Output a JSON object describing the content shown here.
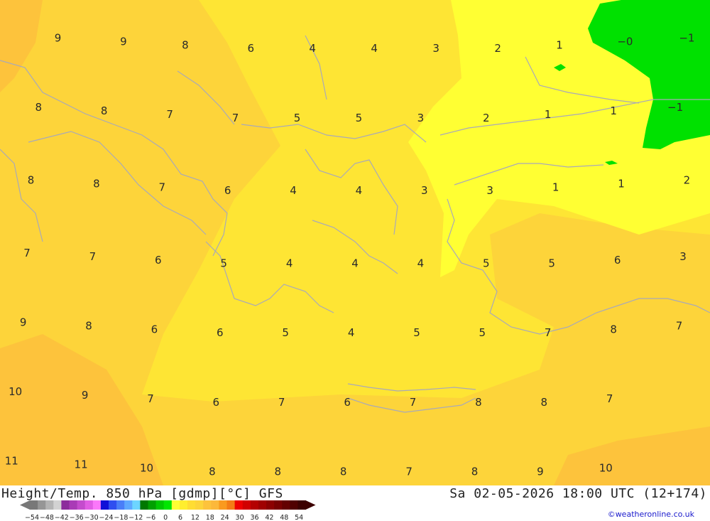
{
  "title": "Height/Temp. 850 hPa [gdmp][°C] GFS",
  "timestamp": "Sa 02-05-2026 18:00 UTC (12+174)",
  "credit": "©weatheronline.co.uk",
  "colors": {
    "zone_6_8": "#fdd43a",
    "zone_4_6": "#fee534",
    "zone_2_4": "#ffff33",
    "zone_neg2_0": "#00e100",
    "zone_8_10": "#fdc33c",
    "coastline": "#a9a9b8"
  },
  "field_values": [
    {
      "label": "9",
      "lon": 13.7,
      "lat": 44.4
    },
    {
      "label": "9",
      "lon": 15.4,
      "lat": 44.3
    },
    {
      "label": "8",
      "lon": 17.0,
      "lat": 44.2
    },
    {
      "label": "6",
      "lon": 18.7,
      "lat": 44.1
    },
    {
      "label": "4",
      "lon": 20.3,
      "lat": 44.1
    },
    {
      "label": "4",
      "lon": 21.9,
      "lat": 44.1
    },
    {
      "label": "3",
      "lon": 23.5,
      "lat": 44.1
    },
    {
      "label": "2",
      "lon": 25.1,
      "lat": 44.1
    },
    {
      "label": "1",
      "lon": 26.7,
      "lat": 44.2
    },
    {
      "label": "-0",
      "lon": 28.4,
      "lat": 44.3
    },
    {
      "label": "-1",
      "lon": 30.0,
      "lat": 44.4
    },
    {
      "label": "8",
      "lon": 13.2,
      "lat": 42.4
    },
    {
      "label": "8",
      "lon": 14.9,
      "lat": 42.3
    },
    {
      "label": "7",
      "lon": 16.6,
      "lat": 42.2
    },
    {
      "label": "7",
      "lon": 18.3,
      "lat": 42.1
    },
    {
      "label": "5",
      "lon": 19.9,
      "lat": 42.1
    },
    {
      "label": "5",
      "lon": 21.5,
      "lat": 42.1
    },
    {
      "label": "3",
      "lon": 23.1,
      "lat": 42.1
    },
    {
      "label": "2",
      "lon": 24.8,
      "lat": 42.1
    },
    {
      "label": "1",
      "lon": 26.4,
      "lat": 42.2
    },
    {
      "label": "1",
      "lon": 28.1,
      "lat": 42.3
    },
    {
      "label": "-1",
      "lon": 29.7,
      "lat": 42.4
    },
    {
      "label": "8",
      "lon": 13.0,
      "lat": 40.3
    },
    {
      "label": "8",
      "lon": 14.7,
      "lat": 40.2
    },
    {
      "label": "7",
      "lon": 16.4,
      "lat": 40.1
    },
    {
      "label": "6",
      "lon": 18.1,
      "lat": 40.0
    },
    {
      "label": "4",
      "lon": 19.8,
      "lat": 40.0
    },
    {
      "label": "4",
      "lon": 21.5,
      "lat": 40.0
    },
    {
      "label": "3",
      "lon": 23.2,
      "lat": 40.0
    },
    {
      "label": "3",
      "lon": 24.9,
      "lat": 40.0
    },
    {
      "label": "1",
      "lon": 26.6,
      "lat": 40.1
    },
    {
      "label": "1",
      "lon": 28.3,
      "lat": 40.2
    },
    {
      "label": "2",
      "lon": 30.0,
      "lat": 40.3
    },
    {
      "label": "7",
      "lon": 12.9,
      "lat": 38.2
    },
    {
      "label": "7",
      "lon": 14.6,
      "lat": 38.1
    },
    {
      "label": "6",
      "lon": 16.3,
      "lat": 38.0
    },
    {
      "label": "5",
      "lon": 18.0,
      "lat": 37.9
    },
    {
      "label": "4",
      "lon": 19.7,
      "lat": 37.9
    },
    {
      "label": "4",
      "lon": 21.4,
      "lat": 37.9
    },
    {
      "label": "4",
      "lon": 23.1,
      "lat": 37.9
    },
    {
      "label": "5",
      "lon": 24.8,
      "lat": 37.9
    },
    {
      "label": "5",
      "lon": 26.5,
      "lat": 37.9
    },
    {
      "label": "6",
      "lon": 28.2,
      "lat": 38.0
    },
    {
      "label": "3",
      "lon": 29.9,
      "lat": 38.1
    },
    {
      "label": "9",
      "lon": 12.8,
      "lat": 36.2
    },
    {
      "label": "8",
      "lon": 14.5,
      "lat": 36.1
    },
    {
      "label": "6",
      "lon": 16.2,
      "lat": 36.0
    },
    {
      "label": "6",
      "lon": 17.9,
      "lat": 35.9
    },
    {
      "label": "5",
      "lon": 19.6,
      "lat": 35.9
    },
    {
      "label": "4",
      "lon": 21.3,
      "lat": 35.9
    },
    {
      "label": "5",
      "lon": 23.0,
      "lat": 35.9
    },
    {
      "label": "5",
      "lon": 24.7,
      "lat": 35.9
    },
    {
      "label": "7",
      "lon": 26.4,
      "lat": 35.9
    },
    {
      "label": "8",
      "lon": 28.1,
      "lat": 36.0
    },
    {
      "label": "7",
      "lon": 29.8,
      "lat": 36.1
    },
    {
      "label": "10",
      "lon": 12.6,
      "lat": 34.2
    },
    {
      "label": "9",
      "lon": 14.4,
      "lat": 34.1
    },
    {
      "label": "7",
      "lon": 16.1,
      "lat": 34.0
    },
    {
      "label": "6",
      "lon": 17.8,
      "lat": 33.9
    },
    {
      "label": "7",
      "lon": 19.5,
      "lat": 33.9
    },
    {
      "label": "6",
      "lon": 21.2,
      "lat": 33.9
    },
    {
      "label": "7",
      "lon": 22.9,
      "lat": 33.9
    },
    {
      "label": "8",
      "lon": 24.6,
      "lat": 33.9
    },
    {
      "label": "8",
      "lon": 26.3,
      "lat": 33.9
    },
    {
      "label": "7",
      "lon": 28.0,
      "lat": 34.0
    },
    {
      "label": "11",
      "lon": 12.5,
      "lat": 32.2
    },
    {
      "label": "11",
      "lon": 14.3,
      "lat": 32.1
    },
    {
      "label": "10",
      "lon": 16.0,
      "lat": 32.0
    },
    {
      "label": "8",
      "lon": 17.7,
      "lat": 31.9
    },
    {
      "label": "8",
      "lon": 19.4,
      "lat": 31.9
    },
    {
      "label": "8",
      "lon": 21.1,
      "lat": 31.9
    },
    {
      "label": "7",
      "lon": 22.8,
      "lat": 31.9
    },
    {
      "label": "8",
      "lon": 24.5,
      "lat": 31.9
    },
    {
      "label": "9",
      "lon": 26.2,
      "lat": 31.9
    },
    {
      "label": "10",
      "lon": 27.9,
      "lat": 32.0
    }
  ],
  "legend": {
    "colors": [
      "#787878",
      "#969696",
      "#b4b4b4",
      "#d2d2d2",
      "#8c2c9c",
      "#a93bb6",
      "#c44ccd",
      "#e05ee4",
      "#fb78fa",
      "#1010d8",
      "#2f4ef0",
      "#4a7ef8",
      "#5ea8ff",
      "#6dd5ff",
      "#007800",
      "#00a000",
      "#00c800",
      "#00e600",
      "#ffff33",
      "#ffee2e",
      "#ffdd33",
      "#fdd43a",
      "#fdc33c",
      "#fcb83b",
      "#fa9a1f",
      "#f47b16",
      "#ee0000",
      "#d10000",
      "#b40000",
      "#a00000",
      "#8c0000",
      "#780000",
      "#640000",
      "#500000",
      "#3c0000"
    ],
    "ticks": [
      "-54",
      "-48",
      "-42",
      "-36",
      "-30",
      "-24",
      "-18",
      "-12",
      "-6",
      "0",
      "6",
      "12",
      "18",
      "24",
      "30",
      "36",
      "42",
      "48",
      "54"
    ]
  }
}
